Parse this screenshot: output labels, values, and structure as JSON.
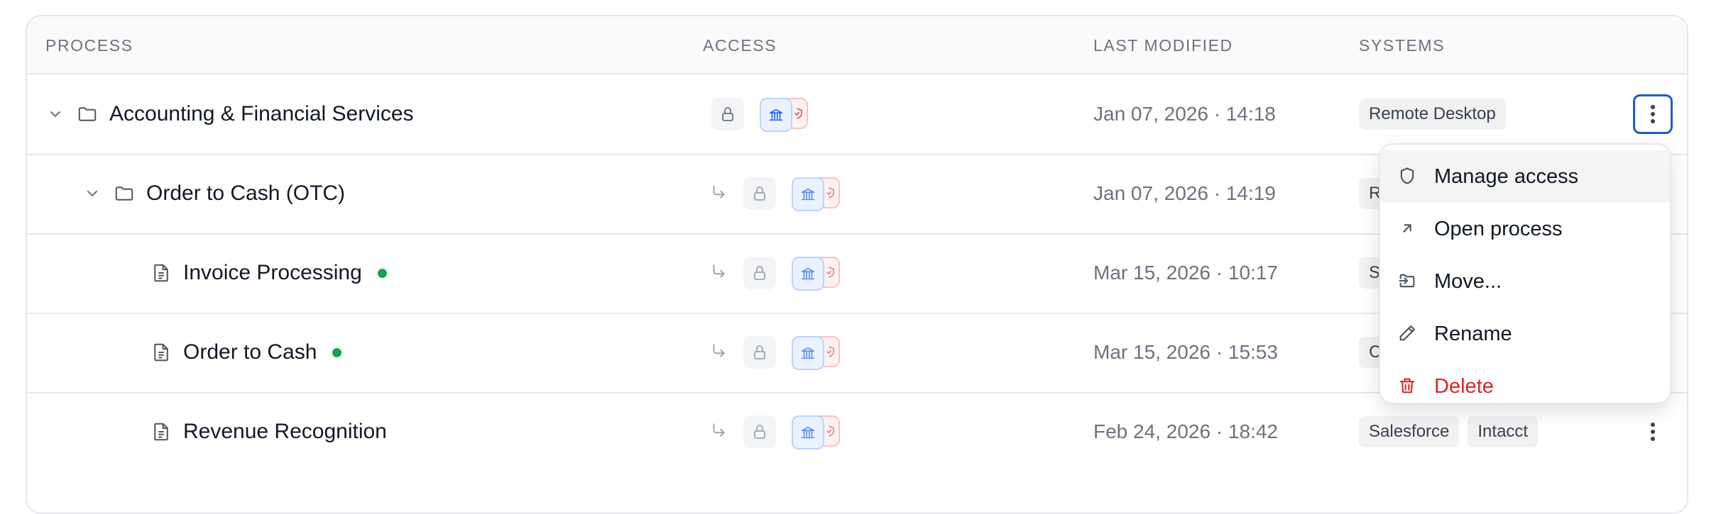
{
  "table": {
    "headers": {
      "process": "PROCESS",
      "access": "ACCESS",
      "last_modified": "LAST MODIFIED",
      "systems": "SYSTEMS"
    },
    "rows": [
      {
        "name": "Accounting & Financial Services",
        "type": "folder",
        "expanded": true,
        "modified": "Jan 07, 2026 · 14:18",
        "systems": [
          "Remote Desktop"
        ],
        "published": false
      },
      {
        "name": "Order to Cash (OTC)",
        "type": "folder",
        "expanded": true,
        "modified": "Jan 07, 2026 · 14:19",
        "systems": [
          "R"
        ],
        "published": false
      },
      {
        "name": "Invoice Processing",
        "type": "document",
        "modified": "Mar 15, 2026 · 10:17",
        "systems": [
          "S"
        ],
        "published": true
      },
      {
        "name": "Order to Cash",
        "type": "document",
        "modified": "Mar 15, 2026 · 15:53",
        "systems": [
          "C"
        ],
        "published": true
      },
      {
        "name": "Revenue Recognition",
        "type": "document",
        "modified": "Feb 24, 2026 · 18:42",
        "systems": [
          "Salesforce",
          "Intacct"
        ],
        "published": false
      }
    ]
  },
  "context_menu": {
    "items": [
      {
        "label": "Manage access",
        "icon": "shield-icon"
      },
      {
        "label": "Open process",
        "icon": "arrow-up-right-icon"
      },
      {
        "label": "Move...",
        "icon": "move-icon"
      },
      {
        "label": "Rename",
        "icon": "pencil-icon"
      },
      {
        "label": "Delete",
        "icon": "trash-icon"
      }
    ]
  },
  "colors": {
    "accent": "#1d5fbf",
    "published_dot": "#16a34a",
    "danger": "#dc2626"
  }
}
